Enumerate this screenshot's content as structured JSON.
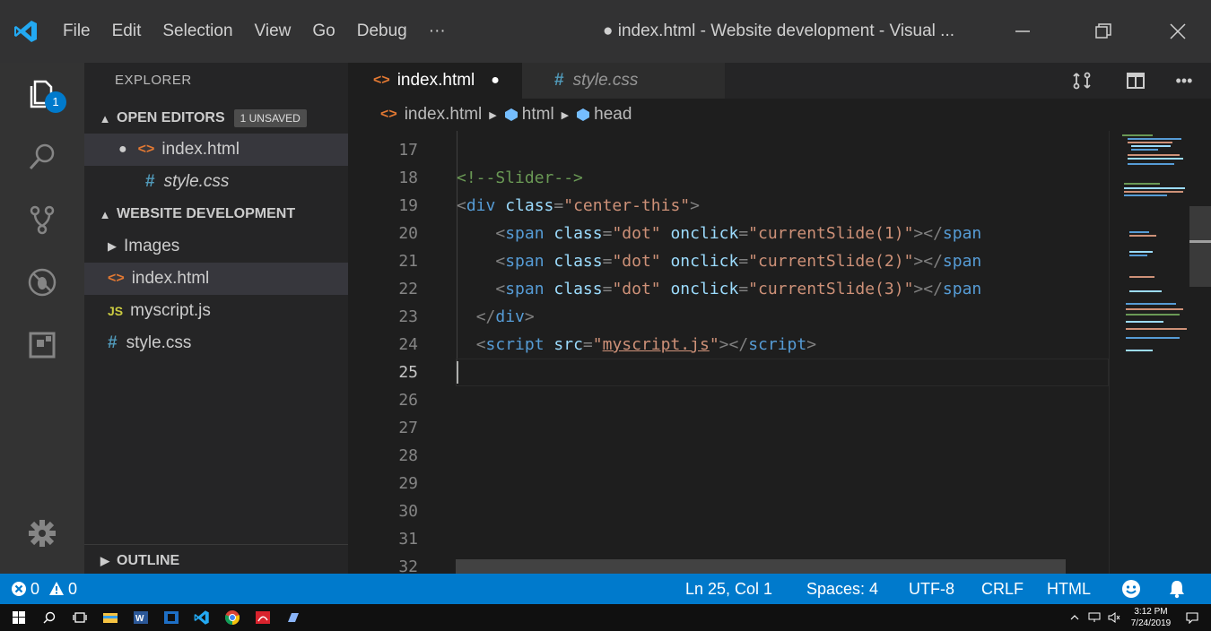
{
  "titlebar": {
    "menu": [
      "File",
      "Edit",
      "Selection",
      "View",
      "Go",
      "Debug",
      "···"
    ],
    "title": "● index.html - Website development - Visual ..."
  },
  "activity": {
    "badge_count": "1"
  },
  "explorer": {
    "title": "EXPLORER",
    "open_editors_label": "OPEN EDITORS",
    "unsaved_badge": "1 UNSAVED",
    "open_editors": [
      {
        "name": "index.html",
        "icon": "html-file-icon",
        "unsaved": true
      },
      {
        "name": "style.css",
        "icon": "css-file-icon",
        "unsaved": false
      }
    ],
    "project_label": "WEBSITE DEVELOPMENT",
    "files": [
      {
        "name": "Images",
        "type": "folder"
      },
      {
        "name": "index.html",
        "type": "html"
      },
      {
        "name": "myscript.js",
        "type": "js"
      },
      {
        "name": "style.css",
        "type": "css"
      }
    ],
    "outline_label": "OUTLINE"
  },
  "tabs": [
    {
      "label": "index.html",
      "active": true,
      "unsaved": true
    },
    {
      "label": "style.css",
      "active": false,
      "unsaved": false
    }
  ],
  "breadcrumb": [
    "index.html",
    "html",
    "head"
  ],
  "editor": {
    "line_numbers": [
      "17",
      "18",
      "19",
      "20",
      "21",
      "22",
      "23",
      "24",
      "25",
      "26",
      "27",
      "28",
      "29",
      "30",
      "31",
      "32"
    ],
    "current_line": "25",
    "code": {
      "l18_comment": "<!--Slider-->",
      "l19_open": "<",
      "l19_tag": "div",
      "l19_attr": "class",
      "l19_eq": "=",
      "l19_val": "\"center-this\"",
      "l19_close": ">",
      "span_open": "<",
      "span_tag": "span",
      "span_attr1": "class",
      "span_eq": "=",
      "span_val1": "\"dot\"",
      "span_attr2": "onclick",
      "span_val2_1": "\"currentSlide(1)\"",
      "span_val2_2": "\"currentSlide(2)\"",
      "span_val2_3": "\"currentSlide(3)\"",
      "span_end": "></",
      "span_end_tag": "span",
      "l23_open": "</",
      "l23_tag": "div",
      "l23_close": ">",
      "l24_open": "<",
      "l24_tag": "script",
      "l24_attr": "src",
      "l24_eq": "=",
      "l24_q1": "\"",
      "l24_val": "myscript.js",
      "l24_q2": "\"",
      "l24_end": "></",
      "l24_end_tag": "script",
      "l24_close": ">"
    }
  },
  "statusbar": {
    "errors": "0",
    "warnings": "0",
    "position": "Ln 25, Col 1",
    "spaces": "Spaces: 4",
    "encoding": "UTF-8",
    "eol": "CRLF",
    "language": "HTML"
  },
  "taskbar": {
    "time": "3:12 PM",
    "date": "7/24/2019"
  },
  "colors": {
    "accent": "#007acc",
    "html_icon": "#e37933",
    "css_icon": "#519aba",
    "js_icon": "#cbcb41"
  }
}
